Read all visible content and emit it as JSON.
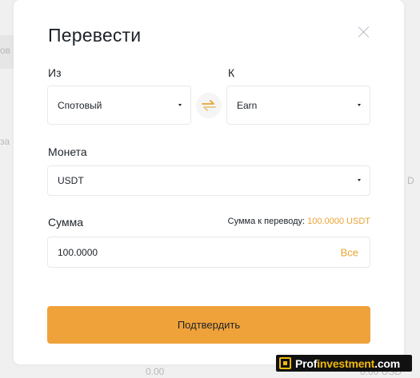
{
  "background": {
    "left_fragments": [
      "ов",
      "за"
    ],
    "right_fragments": [
      "D"
    ],
    "bottom_values": [
      "0.00",
      "0.00 USD"
    ]
  },
  "dialog": {
    "title": "Перевести",
    "close_icon": "close-icon",
    "from": {
      "label": "Из",
      "value": "Спотовый"
    },
    "to": {
      "label": "К",
      "value": "Earn"
    },
    "swap_icon": "swap-arrows-icon",
    "coin": {
      "label": "Монета",
      "value": "USDT"
    },
    "amount": {
      "label": "Сумма",
      "hint_prefix": "Сумма к переводу:",
      "hint_value": "100.0000 USDT",
      "value": "100.0000",
      "all_label": "Все"
    },
    "confirm_label": "Подтвердить"
  },
  "watermark": {
    "part1": "Prof",
    "part2": "investment",
    "part3": ".com"
  },
  "colors": {
    "accent": "#f0a23a",
    "accent_text": "#e8a330",
    "text": "#1e2329",
    "border": "#e7e9ec"
  }
}
